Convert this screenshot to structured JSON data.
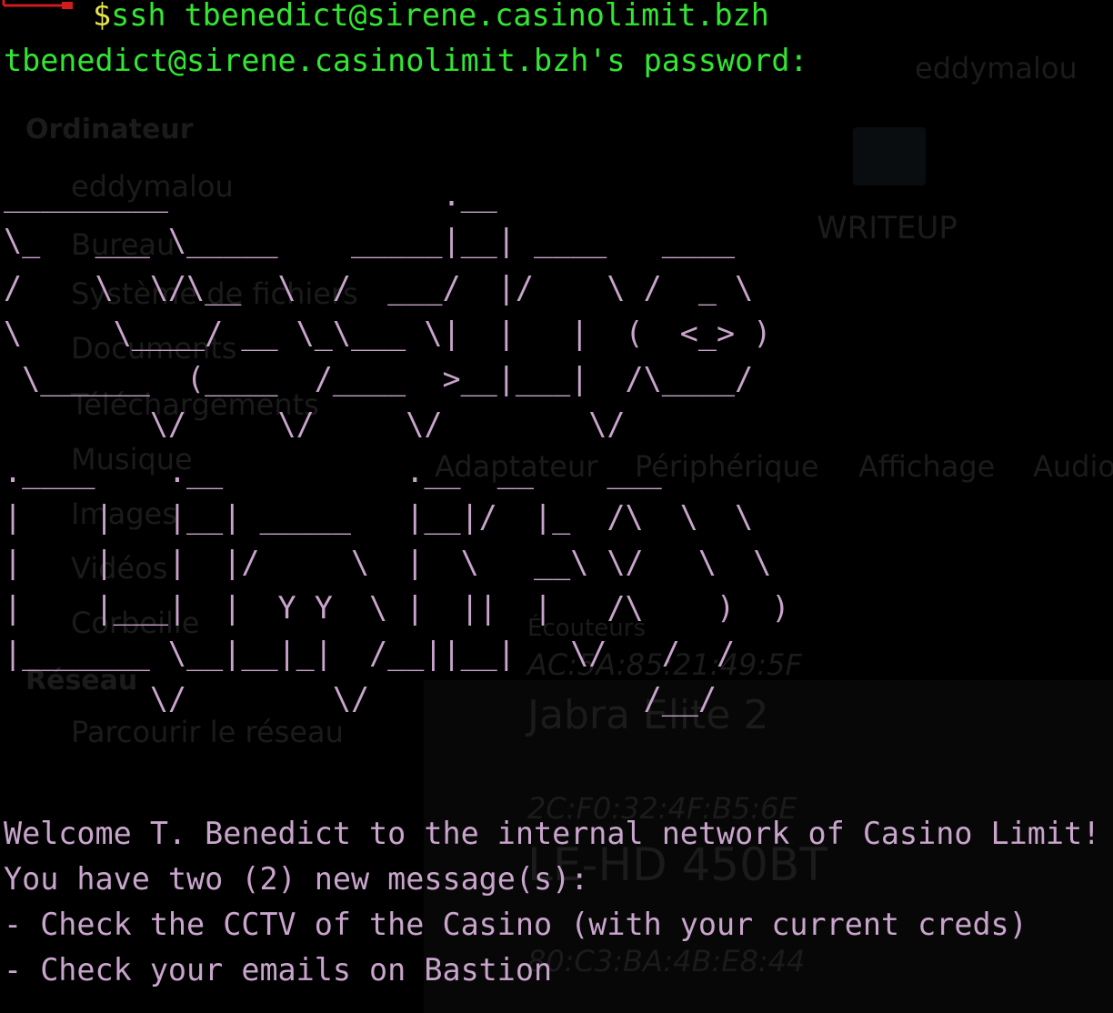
{
  "prompt": {
    "dollar": "$",
    "command": "ssh tbenedict@sirene.casinolimit.bzh"
  },
  "password_prompt": "tbenedict@sirene.casinolimit.bzh's password:",
  "ascii_banner": [
    "_________               .__",
    "\\_   ___ \\_____    _____|__| ____   ____",
    "/    \\  \\/\\__  \\  /  ___/  |/    \\ /  _ \\",
    "\\     \\____/ __ \\_\\___ \\|  |   |  (  <_> )",
    " \\______  (____  /____  >__|___|  /\\____/",
    "        \\/     \\/     \\/        \\/",
    ".____    .__          .__  __    ___",
    "|    |   |__| _____   |__|/  |_  /\\  \\  \\",
    "|    |   |  |/     \\  |  \\   __\\ \\/   \\  \\",
    "|    |___|  |  Y Y  \\ |  ||  |   /\\    )  )",
    "|_______ \\__|__|_|  /__||__|   \\/   /  /",
    "        \\/        \\/               /__/"
  ],
  "messages": [
    "Welcome T. Benedict to the internal network of Casino Limit!",
    "You have two (2) new message(s):",
    "- Check the CCTV of the Casino (with your current creds)",
    "- Check your emails on Bastion"
  ],
  "background_ghost": {
    "sidebar_heading": "Ordinateur",
    "sidebar_items": [
      "eddymalou",
      "Bureau",
      "Système de fichiers",
      "Documents",
      "Téléchargements",
      "Musique",
      "Images",
      "Vidéos",
      "Corbeille"
    ],
    "network_heading": "Réseau",
    "network_item": "Parcourir le réseau",
    "top_right_label": "eddymalou",
    "folder_label": "WRITEUP",
    "tabs": [
      "Adaptateur",
      "Périphérique",
      "Affichage",
      "Audio"
    ],
    "devices": [
      "Jabra Elite 2",
      "LE-HD 450BT"
    ],
    "device_status": "Écouteurs",
    "mac_1": "AC:5A:85:21:49:5F",
    "mac_2": "2C:F0:32:4F:B5:6E",
    "mac_3": "80:C3:BA:4B:E8:44"
  },
  "colors": {
    "background": "#000000",
    "prompt_green": "#32e632",
    "dollar_yellow": "#e7e34a",
    "banner_pink": "#c9a4cc",
    "prompt_red": "#d01c1c"
  }
}
